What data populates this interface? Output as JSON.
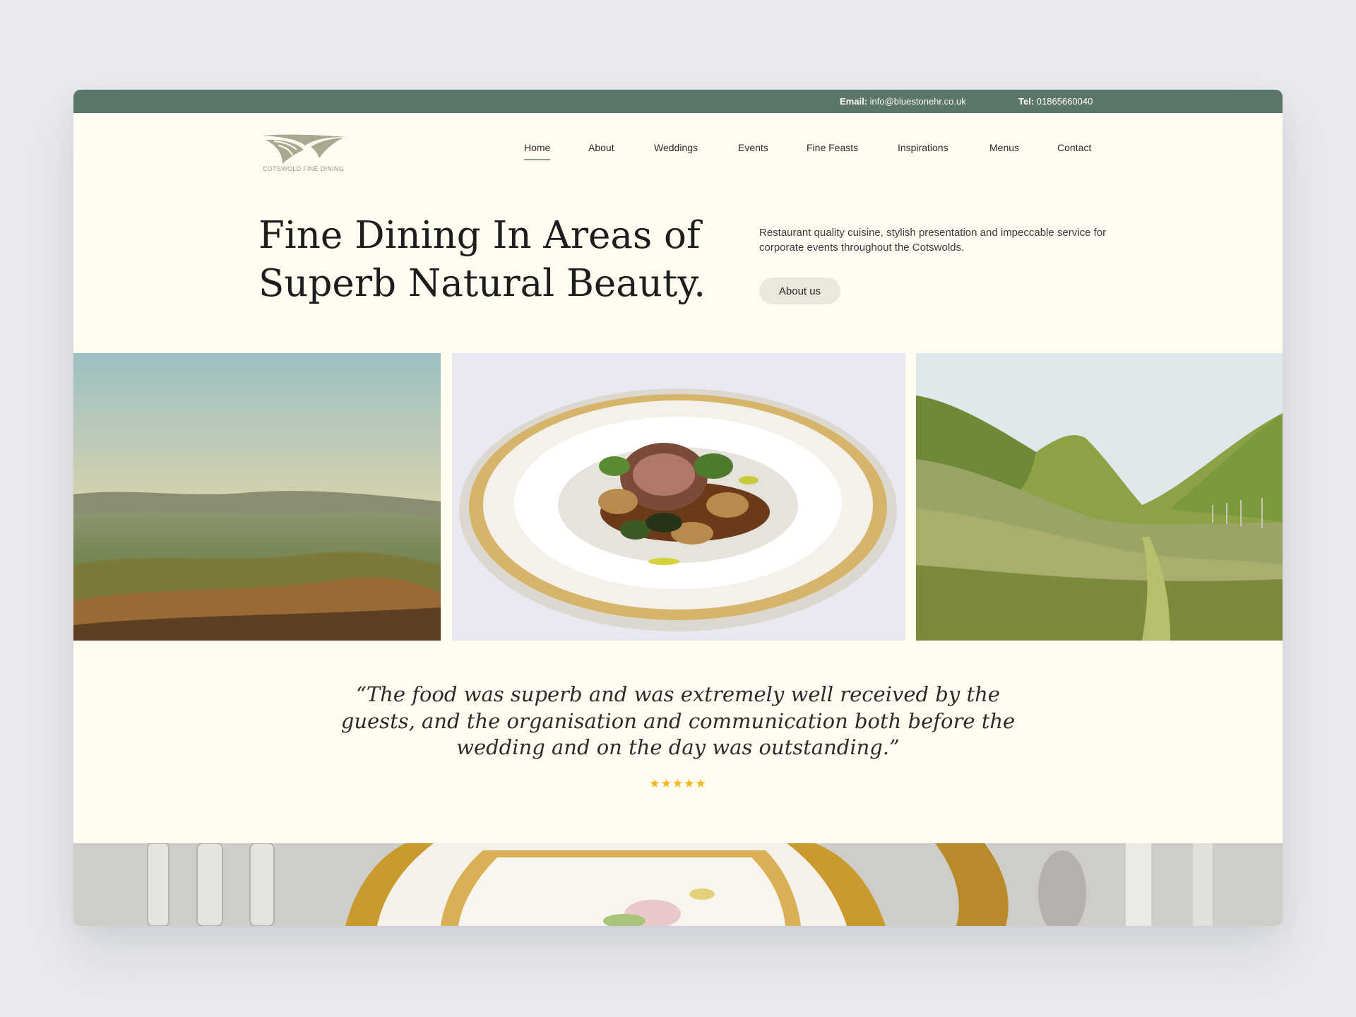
{
  "topbar": {
    "email_label": "Email:",
    "email_value": "info@bluestonehr.co.uk",
    "tel_label": "Tel:",
    "tel_value": "01865660040"
  },
  "logo": {
    "text": "COTSWOLD FINE DINING"
  },
  "nav": {
    "items": [
      {
        "label": "Home",
        "active": true
      },
      {
        "label": "About"
      },
      {
        "label": "Weddings"
      },
      {
        "label": "Events"
      },
      {
        "label": "Fine Feasts"
      },
      {
        "label": "Inspirations"
      },
      {
        "label": "Menus"
      },
      {
        "label": "Contact"
      }
    ]
  },
  "hero": {
    "title_line1": "Fine Dining In Areas of",
    "title_line2": "Superb Natural Beauty.",
    "description": "Restaurant quality cuisine, stylish presentation and impeccable service for corporate events throughout the Cotswolds.",
    "button_label": "About us"
  },
  "gallery": {
    "images": [
      {
        "icon": "landscape-valley-image"
      },
      {
        "icon": "lamb-dish-image"
      },
      {
        "icon": "green-hills-image"
      }
    ]
  },
  "testimonial": {
    "quote": "“The food was superb and was extremely well received by the guests, and the organisation and communication both before the wedding and on the day was outstanding.”",
    "rating": 5,
    "stars": "★★★★★"
  },
  "colors": {
    "topbar": "#5b7569",
    "page_bg": "#fefbf1",
    "accent_underline": "#8aa090",
    "button_bg": "#ece8db",
    "star": "#f2b71a"
  }
}
